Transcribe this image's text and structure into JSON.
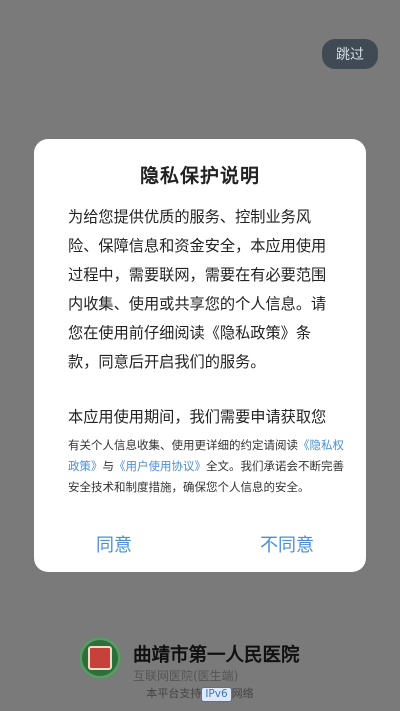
{
  "skip_label": "跳过",
  "dialog": {
    "title": "隐私保护说明",
    "paragraph1": "为给您提供优质的服务、控制业务风险、保障信息和资金安全，本应用使用过程中，需要联网，需要在有必要范围内收集、使用或共享您的个人信息。请您在使用前仔细阅读《隐私政策》条款，同意后开启我们的服务。",
    "paragraph2": "本应用使用期间，我们需要申请获取您的系统权限，我们将在首次调用时逐项",
    "notice": {
      "prefix": "有关个人信息收集、使用更详细的约定请阅读",
      "privacy_link": "《隐私权政策》",
      "joiner": "与",
      "agreement_link": "《用户使用协议》",
      "suffix": "全文。我们承诺会不断完善安全技术和制度措施，确保您个人信息的安全。"
    },
    "agree_label": "同意",
    "disagree_label": "不同意"
  },
  "footer": {
    "hospital_name": "曲靖市第一人民医院",
    "subtitle": "互联网医院(医生端)",
    "platform_prefix": "本平台支持",
    "platform_badge": "IPv6",
    "platform_suffix": "网络"
  },
  "colors": {
    "overlay": "#7a7a7a",
    "link": "#4a8fd6",
    "skip_bg": "#3f4a55"
  }
}
